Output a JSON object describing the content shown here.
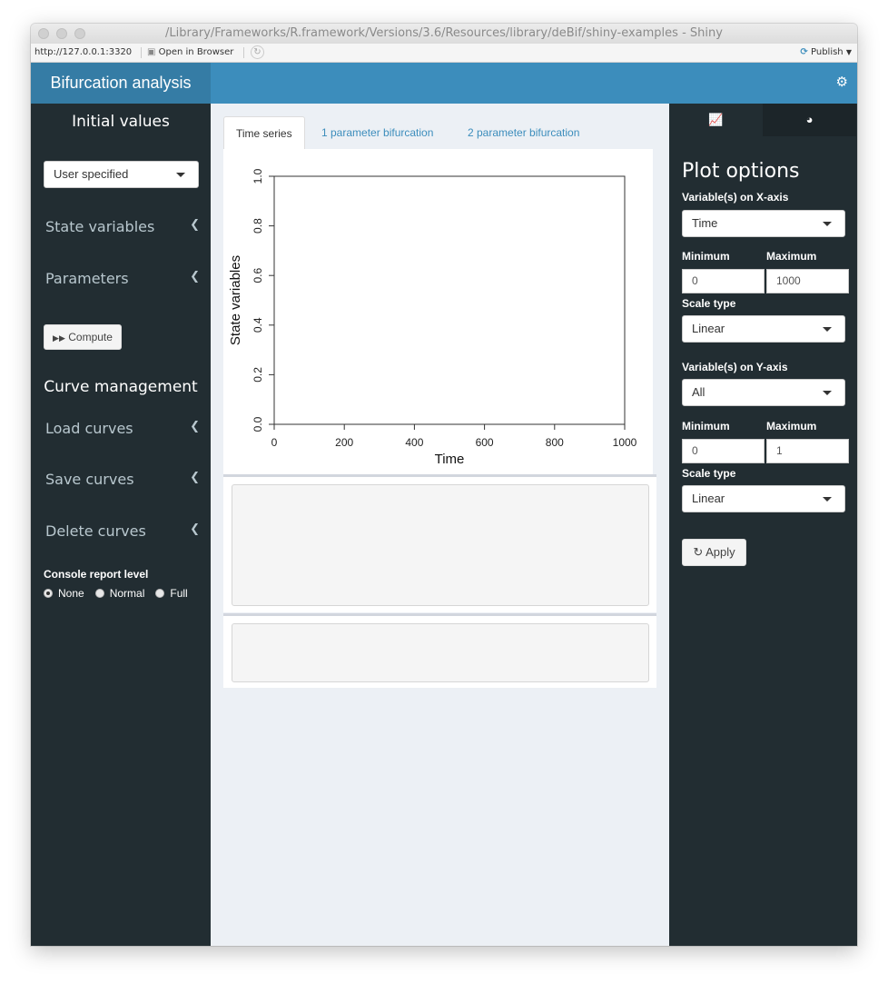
{
  "window": {
    "title": "/Library/Frameworks/R.framework/Versions/3.6/Resources/library/deBif/shiny-examples - Shiny"
  },
  "toolbar": {
    "url": "http://127.0.0.1:3320",
    "open_in_browser": "Open in Browser",
    "publish": "Publish"
  },
  "header": {
    "title": "Bifurcation analysis"
  },
  "sidebar": {
    "initial_values_title": "Initial values",
    "initial_values_select": "User specified",
    "state_variables": "State variables",
    "parameters": "Parameters",
    "compute_button": "Compute",
    "curve_management_title": "Curve management",
    "load_curves": "Load curves",
    "save_curves": "Save curves",
    "delete_curves": "Delete curves",
    "console_report_label": "Console report level",
    "console_options": [
      "None",
      "Normal",
      "Full"
    ],
    "console_selected": "None"
  },
  "tabs": [
    {
      "label": "Time series",
      "active": true
    },
    {
      "label": "1 parameter bifurcation",
      "active": false
    },
    {
      "label": "2 parameter bifurcation",
      "active": false
    }
  ],
  "chart_data": {
    "type": "line",
    "title": "",
    "xlabel": "Time",
    "ylabel": "State variables",
    "xlim": [
      0,
      1000
    ],
    "ylim": [
      0,
      1
    ],
    "x_ticks": [
      "0",
      "200",
      "400",
      "600",
      "800",
      "1000"
    ],
    "y_ticks": [
      "0.0",
      "0.2",
      "0.4",
      "0.6",
      "0.8",
      "1.0"
    ],
    "series": []
  },
  "plot_options": {
    "title": "Plot options",
    "x_axis_label": "Variable(s) on X-axis",
    "x_axis_value": "Time",
    "x_min_label": "Minimum",
    "x_max_label": "Maximum",
    "x_min": "0",
    "x_max": "1000",
    "x_scale_label": "Scale type",
    "x_scale_value": "Linear",
    "y_axis_label": "Variable(s) on Y-axis",
    "y_axis_value": "All",
    "y_min_label": "Minimum",
    "y_max_label": "Maximum",
    "y_min": "0",
    "y_max": "1",
    "y_scale_label": "Scale type",
    "y_scale_value": "Linear",
    "apply_button": "Apply"
  },
  "colors": {
    "header_dark": "#357ca5",
    "header": "#3c8dbc",
    "sidebar": "#222d32",
    "content_bg": "#ecf0f5"
  }
}
